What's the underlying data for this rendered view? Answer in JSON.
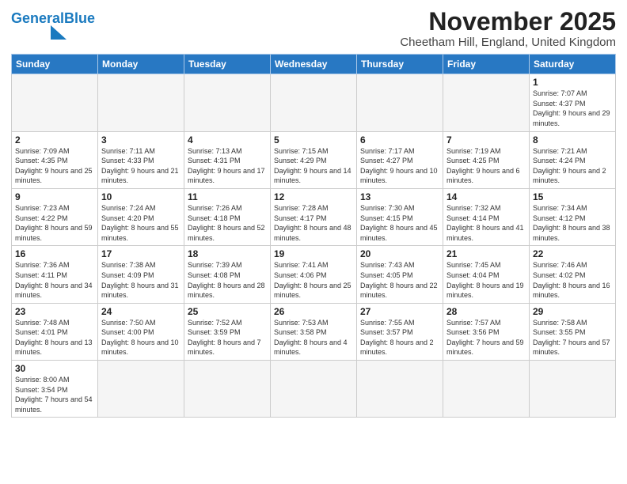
{
  "header": {
    "logo_general": "General",
    "logo_blue": "Blue",
    "title": "November 2025",
    "subtitle": "Cheetham Hill, England, United Kingdom"
  },
  "weekdays": [
    "Sunday",
    "Monday",
    "Tuesday",
    "Wednesday",
    "Thursday",
    "Friday",
    "Saturday"
  ],
  "weeks": [
    [
      {
        "day": "",
        "info": ""
      },
      {
        "day": "",
        "info": ""
      },
      {
        "day": "",
        "info": ""
      },
      {
        "day": "",
        "info": ""
      },
      {
        "day": "",
        "info": ""
      },
      {
        "day": "",
        "info": ""
      },
      {
        "day": "1",
        "info": "Sunrise: 7:07 AM\nSunset: 4:37 PM\nDaylight: 9 hours and 29 minutes."
      }
    ],
    [
      {
        "day": "2",
        "info": "Sunrise: 7:09 AM\nSunset: 4:35 PM\nDaylight: 9 hours and 25 minutes."
      },
      {
        "day": "3",
        "info": "Sunrise: 7:11 AM\nSunset: 4:33 PM\nDaylight: 9 hours and 21 minutes."
      },
      {
        "day": "4",
        "info": "Sunrise: 7:13 AM\nSunset: 4:31 PM\nDaylight: 9 hours and 17 minutes."
      },
      {
        "day": "5",
        "info": "Sunrise: 7:15 AM\nSunset: 4:29 PM\nDaylight: 9 hours and 14 minutes."
      },
      {
        "day": "6",
        "info": "Sunrise: 7:17 AM\nSunset: 4:27 PM\nDaylight: 9 hours and 10 minutes."
      },
      {
        "day": "7",
        "info": "Sunrise: 7:19 AM\nSunset: 4:25 PM\nDaylight: 9 hours and 6 minutes."
      },
      {
        "day": "8",
        "info": "Sunrise: 7:21 AM\nSunset: 4:24 PM\nDaylight: 9 hours and 2 minutes."
      }
    ],
    [
      {
        "day": "9",
        "info": "Sunrise: 7:23 AM\nSunset: 4:22 PM\nDaylight: 8 hours and 59 minutes."
      },
      {
        "day": "10",
        "info": "Sunrise: 7:24 AM\nSunset: 4:20 PM\nDaylight: 8 hours and 55 minutes."
      },
      {
        "day": "11",
        "info": "Sunrise: 7:26 AM\nSunset: 4:18 PM\nDaylight: 8 hours and 52 minutes."
      },
      {
        "day": "12",
        "info": "Sunrise: 7:28 AM\nSunset: 4:17 PM\nDaylight: 8 hours and 48 minutes."
      },
      {
        "day": "13",
        "info": "Sunrise: 7:30 AM\nSunset: 4:15 PM\nDaylight: 8 hours and 45 minutes."
      },
      {
        "day": "14",
        "info": "Sunrise: 7:32 AM\nSunset: 4:14 PM\nDaylight: 8 hours and 41 minutes."
      },
      {
        "day": "15",
        "info": "Sunrise: 7:34 AM\nSunset: 4:12 PM\nDaylight: 8 hours and 38 minutes."
      }
    ],
    [
      {
        "day": "16",
        "info": "Sunrise: 7:36 AM\nSunset: 4:11 PM\nDaylight: 8 hours and 34 minutes."
      },
      {
        "day": "17",
        "info": "Sunrise: 7:38 AM\nSunset: 4:09 PM\nDaylight: 8 hours and 31 minutes."
      },
      {
        "day": "18",
        "info": "Sunrise: 7:39 AM\nSunset: 4:08 PM\nDaylight: 8 hours and 28 minutes."
      },
      {
        "day": "19",
        "info": "Sunrise: 7:41 AM\nSunset: 4:06 PM\nDaylight: 8 hours and 25 minutes."
      },
      {
        "day": "20",
        "info": "Sunrise: 7:43 AM\nSunset: 4:05 PM\nDaylight: 8 hours and 22 minutes."
      },
      {
        "day": "21",
        "info": "Sunrise: 7:45 AM\nSunset: 4:04 PM\nDaylight: 8 hours and 19 minutes."
      },
      {
        "day": "22",
        "info": "Sunrise: 7:46 AM\nSunset: 4:02 PM\nDaylight: 8 hours and 16 minutes."
      }
    ],
    [
      {
        "day": "23",
        "info": "Sunrise: 7:48 AM\nSunset: 4:01 PM\nDaylight: 8 hours and 13 minutes."
      },
      {
        "day": "24",
        "info": "Sunrise: 7:50 AM\nSunset: 4:00 PM\nDaylight: 8 hours and 10 minutes."
      },
      {
        "day": "25",
        "info": "Sunrise: 7:52 AM\nSunset: 3:59 PM\nDaylight: 8 hours and 7 minutes."
      },
      {
        "day": "26",
        "info": "Sunrise: 7:53 AM\nSunset: 3:58 PM\nDaylight: 8 hours and 4 minutes."
      },
      {
        "day": "27",
        "info": "Sunrise: 7:55 AM\nSunset: 3:57 PM\nDaylight: 8 hours and 2 minutes."
      },
      {
        "day": "28",
        "info": "Sunrise: 7:57 AM\nSunset: 3:56 PM\nDaylight: 7 hours and 59 minutes."
      },
      {
        "day": "29",
        "info": "Sunrise: 7:58 AM\nSunset: 3:55 PM\nDaylight: 7 hours and 57 minutes."
      }
    ],
    [
      {
        "day": "30",
        "info": "Sunrise: 8:00 AM\nSunset: 3:54 PM\nDaylight: 7 hours and 54 minutes."
      },
      {
        "day": "",
        "info": ""
      },
      {
        "day": "",
        "info": ""
      },
      {
        "day": "",
        "info": ""
      },
      {
        "day": "",
        "info": ""
      },
      {
        "day": "",
        "info": ""
      },
      {
        "day": "",
        "info": ""
      }
    ]
  ]
}
